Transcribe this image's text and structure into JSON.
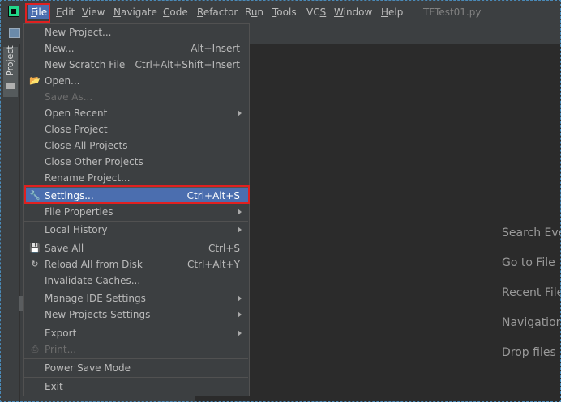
{
  "menubar": {
    "items": [
      {
        "label": "File",
        "accel": "F",
        "rest": "ile",
        "active": true
      },
      {
        "label": "Edit",
        "accel": "E",
        "rest": "dit"
      },
      {
        "label": "View",
        "accel": "V",
        "rest": "iew"
      },
      {
        "label": "Navigate",
        "accel": "N",
        "rest": "avigate"
      },
      {
        "label": "Code",
        "accel": "C",
        "rest": "ode"
      },
      {
        "label": "Refactor",
        "accel": "R",
        "rest": "efactor"
      },
      {
        "label": "Run",
        "pre": "R",
        "accel": "u",
        "rest": "n"
      },
      {
        "label": "Tools",
        "accel": "T",
        "rest": "ools"
      },
      {
        "label": "VCS",
        "pre": "VC",
        "accel": "S",
        "rest": ""
      },
      {
        "label": "Window",
        "accel": "W",
        "rest": "indow"
      },
      {
        "label": "Help",
        "accel": "H",
        "rest": "elp"
      }
    ],
    "title": "TFTest01.py"
  },
  "sidebar": {
    "project_tab": "Project"
  },
  "file_menu": {
    "items": [
      {
        "label": "New Project...",
        "shortcut": ""
      },
      {
        "label": "New...",
        "shortcut": "Alt+Insert"
      },
      {
        "label": "New Scratch File",
        "shortcut": "Ctrl+Alt+Shift+Insert"
      },
      {
        "label": "Open...",
        "shortcut": "",
        "icon": "folder-open-icon"
      },
      {
        "label": "Save As...",
        "shortcut": "",
        "disabled": true
      },
      {
        "label": "Open Recent",
        "submenu": true
      },
      {
        "label": "Close Project"
      },
      {
        "label": "Close All Projects"
      },
      {
        "label": "Close Other Projects"
      },
      {
        "label": "Rename Project..."
      },
      {
        "label": "Settings...",
        "shortcut": "Ctrl+Alt+S",
        "selected": true,
        "icon": "wrench-icon"
      },
      {
        "label": "File Properties",
        "submenu": true
      },
      {
        "label": "Local History",
        "submenu": true
      },
      {
        "label": "Save All",
        "shortcut": "Ctrl+S",
        "icon": "save-icon"
      },
      {
        "label": "Reload All from Disk",
        "shortcut": "Ctrl+Alt+Y",
        "icon": "reload-icon"
      },
      {
        "label": "Invalidate Caches..."
      },
      {
        "label": "Manage IDE Settings",
        "submenu": true
      },
      {
        "label": "New Projects Settings",
        "submenu": true
      },
      {
        "label": "Export",
        "submenu": true
      },
      {
        "label": "Print...",
        "disabled": true,
        "icon": "print-icon"
      },
      {
        "label": "Power Save Mode"
      },
      {
        "label": "Exit"
      }
    ]
  },
  "welcome": {
    "lines": [
      "Search Eve",
      "Go to File",
      "Recent File",
      "Navigation",
      "Drop files"
    ]
  },
  "colors": {
    "selection": "#4b6eaf",
    "highlight_box": "#e02020",
    "background": "#2b2b2b"
  }
}
